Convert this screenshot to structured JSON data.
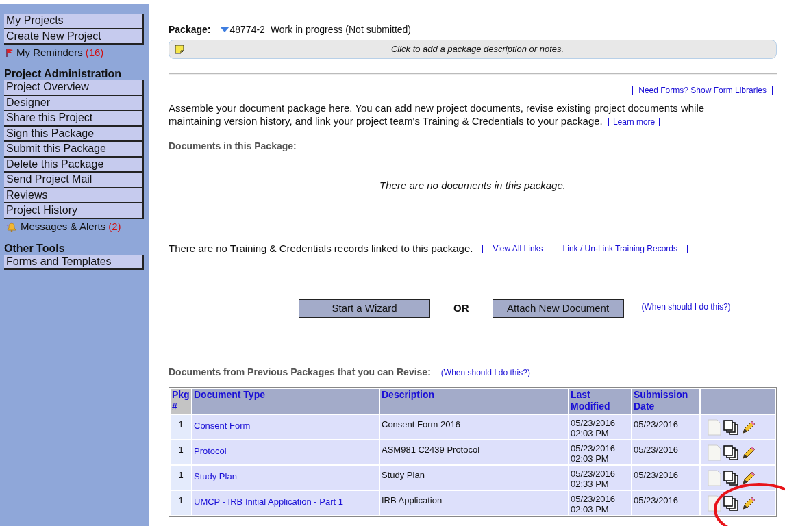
{
  "sidebar": {
    "top_items": [
      {
        "label": "My Projects",
        "kind": "link"
      },
      {
        "label": "Create New Project",
        "kind": "link"
      },
      {
        "label": "My Reminders",
        "count": "(16)",
        "kind": "flag"
      }
    ],
    "sections": [
      {
        "heading": "Project Administration",
        "items": [
          {
            "label": "Project Overview",
            "kind": "link"
          },
          {
            "label": "Designer",
            "kind": "link"
          },
          {
            "label": "Share this Project",
            "kind": "link"
          },
          {
            "label": "Sign this Package",
            "kind": "link"
          },
          {
            "label": "Submit this Package",
            "kind": "link"
          },
          {
            "label": "Delete this Package",
            "kind": "link"
          },
          {
            "label": "Send Project Mail",
            "kind": "link"
          },
          {
            "label": "Reviews",
            "kind": "link"
          },
          {
            "label": "Project History",
            "kind": "link"
          },
          {
            "label": "Messages & Alerts",
            "count": "(2)",
            "kind": "bell"
          }
        ]
      },
      {
        "heading": "Other Tools",
        "items": [
          {
            "label": "Forms and Templates",
            "kind": "link"
          }
        ]
      }
    ]
  },
  "package": {
    "label": "Package:",
    "number": "48774-2",
    "status": "Work in progress (Not submitted)",
    "notes_prompt": "Click to add a package description or notes."
  },
  "form_links": [
    "Need Forms? Show Form Libraries"
  ],
  "intro": "Assemble your document package here. You can add new project documents, revise existing project documents while maintaining version history, and link your project team's Training & Credentials to your package.",
  "intro_link": "Learn more",
  "documents_heading": "Documents in this Package:",
  "no_documents": "There are no documents in this package.",
  "training_text": "There are no Training & Credentials records linked to this package.",
  "training_links": [
    "View All Links",
    "Link / Un-Link Training Records"
  ],
  "actions": {
    "wizard": "Start a Wizard",
    "or": "OR",
    "attach": "Attach New Document",
    "help": "(When should I do this?)"
  },
  "revise": {
    "heading": "Documents from Previous Packages that you can Revise:",
    "help": "(When should I do this?)",
    "columns": [
      "Pkg #",
      "Document Type",
      "Description",
      "Last Modified",
      "Submission Date"
    ],
    "rows": [
      {
        "pkg": "1",
        "type": "Consent Form",
        "description": "Consent Form 2016",
        "modified": [
          "05/23/2016",
          "02:03 PM"
        ],
        "submitted": "05/23/2016"
      },
      {
        "pkg": "1",
        "type": "Protocol",
        "description": "ASM981 C2439 Protocol",
        "modified": [
          "05/23/2016",
          "02:03 PM"
        ],
        "submitted": "05/23/2016"
      },
      {
        "pkg": "1",
        "type": "Study Plan",
        "description": "Study Plan",
        "modified": [
          "05/23/2016",
          "02:33 PM"
        ],
        "submitted": "05/23/2016"
      },
      {
        "pkg": "1",
        "type": "UMCP - IRB Initial Application - Part 1",
        "description": "IRB Application",
        "modified": [
          "05/23/2016",
          "02:03 PM"
        ],
        "submitted": "05/23/2016"
      }
    ]
  }
}
